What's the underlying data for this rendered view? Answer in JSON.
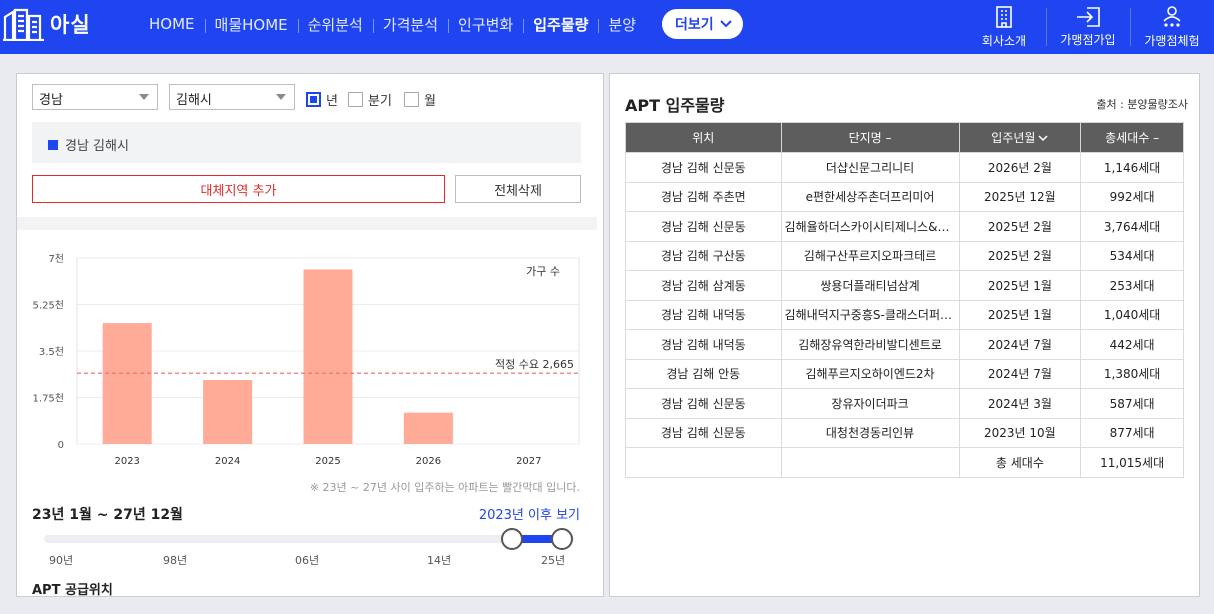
{
  "header": {
    "logo_text": "아실",
    "nav": [
      "HOME",
      "매물HOME",
      "순위분석",
      "가격분석",
      "인구변화",
      "입주물량",
      "분양"
    ],
    "active_nav": "입주물량",
    "more_label": "더보기",
    "right_menu": [
      {
        "label": "회사소개",
        "icon": "building-icon"
      },
      {
        "label": "가맹점가입",
        "icon": "login-icon"
      },
      {
        "label": "가맹점체험",
        "icon": "user-stars-icon"
      }
    ]
  },
  "filters": {
    "province": "경남",
    "city": "김해시",
    "periods": [
      {
        "label": "년",
        "checked": true
      },
      {
        "label": "분기",
        "checked": false
      },
      {
        "label": "월",
        "checked": false
      }
    ],
    "selected_region": "경남 김해시",
    "add_region_label": "대체지역 추가",
    "delete_all_label": "전체삭제"
  },
  "chart_data": {
    "type": "bar",
    "categories": [
      "2023",
      "2024",
      "2025",
      "2026",
      "2027"
    ],
    "values": [
      4550,
      2410,
      6570,
      1180,
      0
    ],
    "legend": "가구 수",
    "ylim": [
      0,
      7000
    ],
    "yticks": [
      "0",
      "1.75천",
      "3.5천",
      "5.25천",
      "7천"
    ],
    "ytick_values": [
      0,
      1750,
      3500,
      5250,
      7000
    ],
    "reference_line": {
      "label": "적정 수요 2,665",
      "value": 2665
    },
    "bar_color": "#ffab98",
    "grid": true
  },
  "chart_note": "※ 23년 ~ 27년 사이 입주하는 아파트는 빨간막대 입니다.",
  "period": {
    "label": "23년 1월 ~ 27년 12월",
    "after_link": "2023년 이후 보기",
    "ticks": [
      "90년",
      "98년",
      "06년",
      "14년",
      "25년"
    ]
  },
  "supply_title": "APT 공급위치",
  "table": {
    "title": "APT 입주물량",
    "source": "출처 : 분양물량조사",
    "columns": [
      "위치",
      "단지명 –",
      "입주년월",
      "총세대수 –"
    ],
    "rows": [
      [
        "경남 김해 신문동",
        "더샵신문그리니티",
        "2026년 2월",
        "1,146세대"
      ],
      [
        "경남 김해 주촌면",
        "e편한세상주촌더프리미어",
        "2025년 12월",
        "992세대"
      ],
      [
        "경남 김해 신문동",
        "김해율하더스카이시티제니스&프...",
        "2025년 2월",
        "3,764세대"
      ],
      [
        "경남 김해 구산동",
        "김해구산푸르지오파크테르",
        "2025년 2월",
        "534세대"
      ],
      [
        "경남 김해 삼계동",
        "쌍용더플래티넘삼계",
        "2025년 1월",
        "253세대"
      ],
      [
        "경남 김해 내덕동",
        "김해내덕지구중흥S-클래스더퍼스트",
        "2025년 1월",
        "1,040세대"
      ],
      [
        "경남 김해 내덕동",
        "김해장유역한라비발디센트로",
        "2024년 7월",
        "442세대"
      ],
      [
        "경남 김해 안동",
        "김해푸르지오하이엔드2차",
        "2024년 7월",
        "1,380세대"
      ],
      [
        "경남 김해 신문동",
        "장유자이더파크",
        "2024년 3월",
        "587세대"
      ],
      [
        "경남 김해 신문동",
        "대청천경동리인뷰",
        "2023년 10월",
        "877세대"
      ]
    ],
    "total_label": "총 세대수",
    "total_value": "11,015세대"
  }
}
